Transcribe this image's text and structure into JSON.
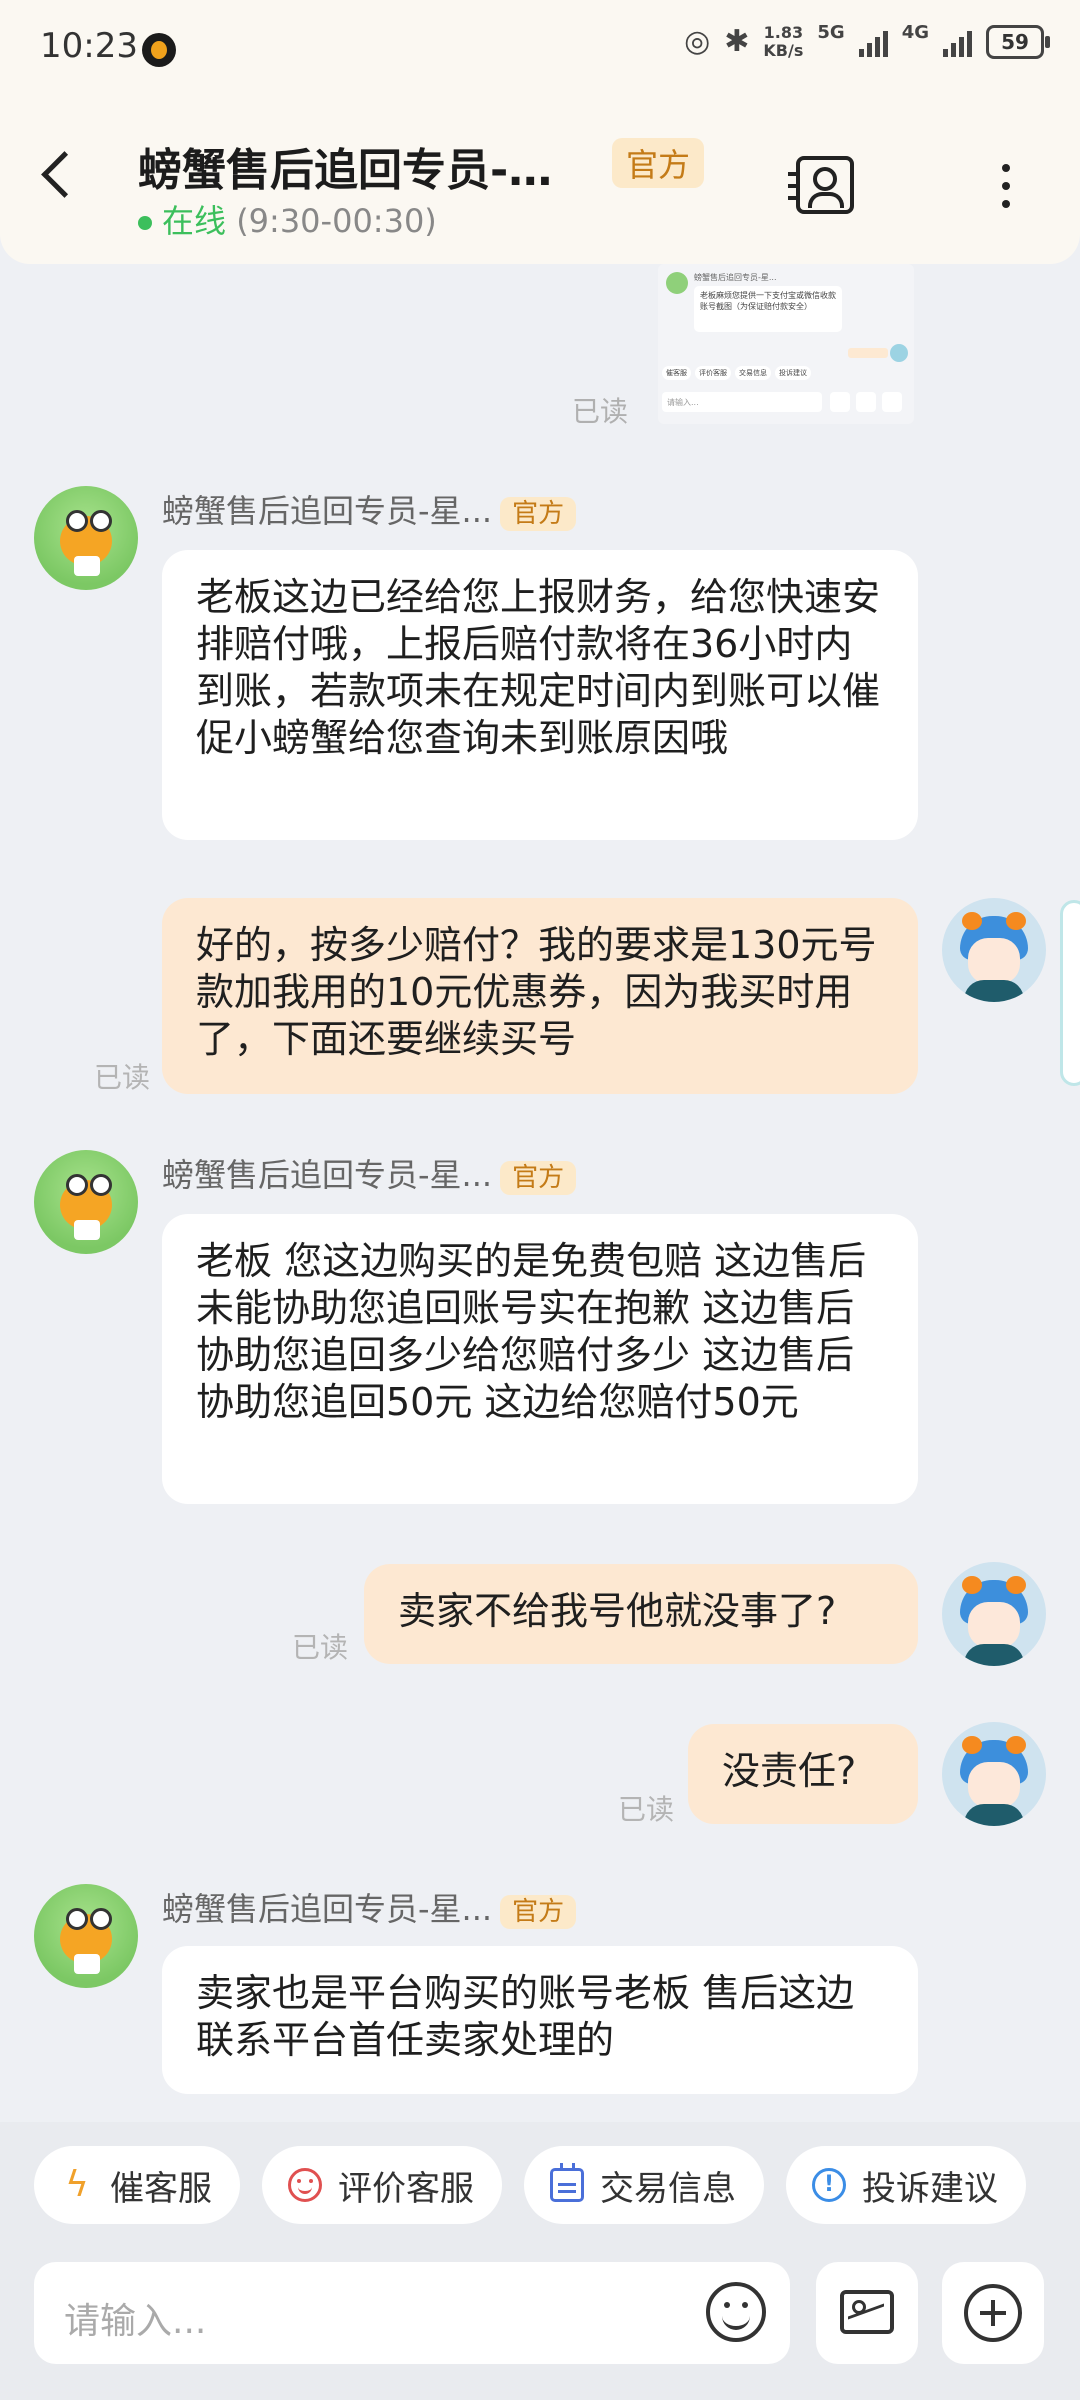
{
  "status_bar": {
    "time": "10:23",
    "net_speed_value": "1.83",
    "net_speed_unit": "KB/s",
    "net1": "5G",
    "net2": "4G",
    "battery": "59"
  },
  "header": {
    "title": "螃蟹售后追回专员-星...",
    "official_badge": "官方",
    "online_label": "在线",
    "hours": "(9:30-00:30)"
  },
  "thumbnail": {
    "name": "螃蟹售后追回专员-星...",
    "text": "老板麻烦您提供一下支付宝或微信收款账号截图（为保证赔付款安全）",
    "chips": [
      "催客服",
      "评价客服",
      "交易信息",
      "投诉建议"
    ],
    "input_placeholder": "请输入...",
    "read": "已读"
  },
  "messages": [
    {
      "side": "left",
      "name": "螃蟹售后追回专员-星...",
      "badge": "官方",
      "text": "老板这边已经给您上报财务，给您快速安排赔付哦，上报后赔付款将在36小时内到账，若款项未在规定时间内到账可以催促小螃蟹给您查询未到账原因哦"
    },
    {
      "side": "right",
      "read": "已读",
      "text": "好的，按多少赔付？我的要求是130元号款加我用的10元优惠券，因为我买时用了，下面还要继续买号"
    },
    {
      "side": "left",
      "name": "螃蟹售后追回专员-星...",
      "badge": "官方",
      "text": "老板 您这边购买的是免费包赔 这边售后未能协助您追回账号实在抱歉 这边售后协助您追回多少给您赔付多少 这边售后协助您追回50元 这边给您赔付50元"
    },
    {
      "side": "right",
      "read": "已读",
      "text": "卖家不给我号他就没事了?"
    },
    {
      "side": "right",
      "read": "已读",
      "text": "没责任?"
    },
    {
      "side": "left",
      "name": "螃蟹售后追回专员-星...",
      "badge": "官方",
      "text": "卖家也是平台购买的账号老板 售后这边联系平台首任卖家处理的"
    }
  ],
  "quick_actions": [
    {
      "label": "催客服",
      "icon": "lightning-icon"
    },
    {
      "label": "评价客服",
      "icon": "smiley-icon"
    },
    {
      "label": "交易信息",
      "icon": "calendar-icon"
    },
    {
      "label": "投诉建议",
      "icon": "alert-icon"
    }
  ],
  "composer": {
    "placeholder": "请输入..."
  },
  "colors": {
    "online_green": "#3cbf5c",
    "official_badge_bg": "#fce9c9",
    "official_badge_text": "#c47b17",
    "outgoing_bubble": "#fde8d2"
  }
}
